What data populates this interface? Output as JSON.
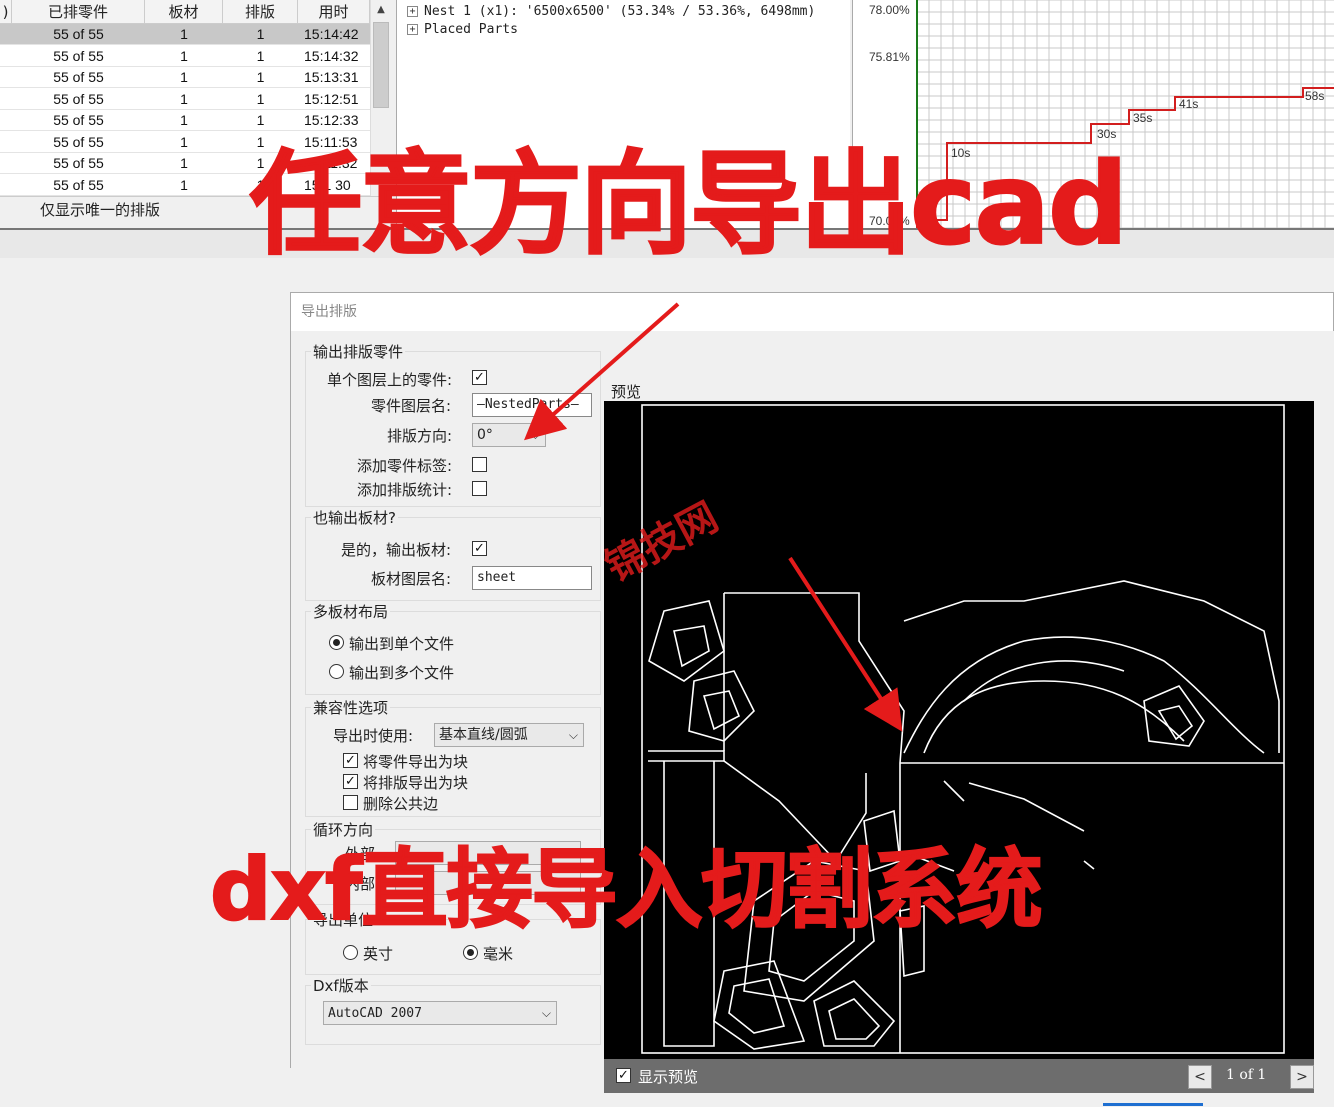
{
  "nest_table": {
    "columns": [
      ")",
      "已排零件",
      "板材",
      "排版",
      "用时"
    ],
    "rows": [
      {
        "parts": "55 of 55",
        "sheets": "1",
        "nests": "1",
        "time": "15:14:42",
        "selected": true
      },
      {
        "parts": "55 of 55",
        "sheets": "1",
        "nests": "1",
        "time": "15:14:32"
      },
      {
        "parts": "55 of 55",
        "sheets": "1",
        "nests": "1",
        "time": "15:13:31"
      },
      {
        "parts": "55 of 55",
        "sheets": "1",
        "nests": "1",
        "time": "15:12:51"
      },
      {
        "parts": "55 of 55",
        "sheets": "1",
        "nests": "1",
        "time": "15:12:33"
      },
      {
        "parts": "55 of 55",
        "sheets": "1",
        "nests": "1",
        "time": "15:11:53"
      },
      {
        "parts": "55 of 55",
        "sheets": "1",
        "nests": "1",
        "time": "15:11:32"
      },
      {
        "parts": "55 of 55",
        "sheets": "1",
        "nests": "1",
        "time": "15:1 30"
      }
    ],
    "filter_label": "仅显示唯一的排版"
  },
  "tree": {
    "items": [
      {
        "label": "Nest 1 (x1): '6500x6500' (53.34% / 53.36%, 6498mm)"
      },
      {
        "label": "Placed Parts"
      }
    ]
  },
  "graph": {
    "y_labels": [
      "78.00%",
      "75.81%",
      "70.00%"
    ],
    "step_labels": [
      "10s",
      "30s",
      "35s",
      "41s",
      "58s"
    ],
    "line_color": "#d21e1e"
  },
  "overlay": {
    "headline": "任意方向导出cad",
    "bottom": "dxf直接导入切割系统",
    "watermark": "锦技网",
    "color": "#e41b1b"
  },
  "dialog": {
    "title": "导出排版",
    "output_parts": {
      "group": "输出排版零件",
      "single_layer_label": "单个图层上的零件:",
      "single_layer_checked": true,
      "layer_name_label": "零件图层名:",
      "layer_name_value": "—NestedParts—",
      "direction_label": "排版方向:",
      "direction_value": "0°",
      "add_tags_label": "添加零件标签:",
      "add_tags_checked": false,
      "add_stats_label": "添加排版统计:",
      "add_stats_checked": false
    },
    "output_sheet": {
      "group": "也输出板材?",
      "yes_label": "是的，输出板材:",
      "yes_checked": true,
      "sheet_layer_label": "板材图层名:",
      "sheet_layer_value": "sheet"
    },
    "multi_sheet": {
      "group": "多板材布局",
      "single_file": "输出到单个文件",
      "multi_files": "输出到多个文件",
      "selected": "single"
    },
    "compat": {
      "group": "兼容性选项",
      "export_using_label": "导出时使用:",
      "export_using_value": "基本直线/圆弧",
      "parts_as_blocks": "将零件导出为块",
      "parts_as_blocks_checked": true,
      "nests_as_blocks": "将排版导出为块",
      "nests_as_blocks_checked": true,
      "remove_common": "删除公共边",
      "remove_common_checked": false
    },
    "loop": {
      "group": "循环方向",
      "outer_label": "外部",
      "inner_label": "内部"
    },
    "units": {
      "group": "导出单位",
      "inch": "英寸",
      "mm": "毫米",
      "selected": "mm"
    },
    "dxf": {
      "group": "Dxf版本",
      "version": "AutoCAD 2007"
    },
    "preview": {
      "label": "预览",
      "show_preview": "显示预览",
      "show_checked": true,
      "prev": "<",
      "next": ">",
      "page": "1 of 1"
    }
  }
}
